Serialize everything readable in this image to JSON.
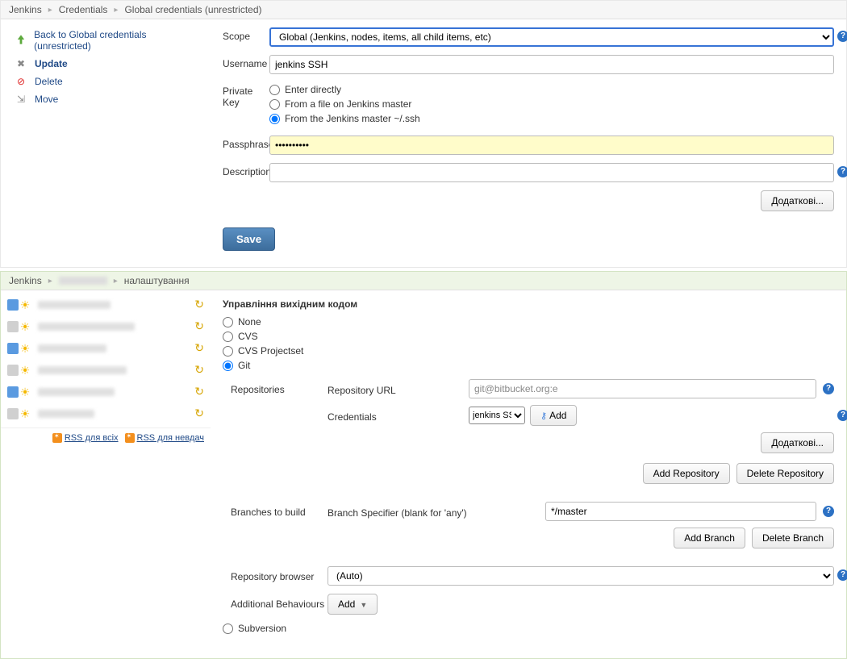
{
  "panel1": {
    "breadcrumbs": [
      "Jenkins",
      "Credentials",
      "Global credentials (unrestricted)"
    ],
    "sidebar": [
      {
        "icon": "arrow-up",
        "label": "Back to Global credentials (unrestricted)"
      },
      {
        "icon": "wrench",
        "label": "Update",
        "active": true
      },
      {
        "icon": "block",
        "label": "Delete"
      },
      {
        "icon": "move",
        "label": "Move"
      }
    ],
    "form": {
      "scope_label": "Scope",
      "scope_value": "Global (Jenkins, nodes, items, all child items, etc)",
      "username_label": "Username",
      "username_value": "jenkins SSH",
      "privatekey_label": "Private Key",
      "pk_options": [
        "Enter directly",
        "From a file on Jenkins master",
        "From the Jenkins master ~/.ssh"
      ],
      "pk_selected": 2,
      "passphrase_label": "Passphrase",
      "passphrase_value": "••••••••••",
      "description_label": "Description",
      "description_value": "",
      "advanced_btn": "Додаткові...",
      "save_btn": "Save"
    }
  },
  "panel2": {
    "breadcrumbs": [
      "Jenkins",
      "",
      "налаштування"
    ],
    "rss_all": "RSS для всіх",
    "rss_fail": "RSS для невдач",
    "scm": {
      "title": "Управління вихідним кодом",
      "options": [
        "None",
        "CVS",
        "CVS Projectset",
        "Git",
        "Subversion"
      ],
      "selected": 3,
      "repositories_label": "Repositories",
      "repo_url_label": "Repository URL",
      "repo_url_value": "git@bitbucket.org:e",
      "credentials_label": "Credentials",
      "credentials_value": "jenkins SSH",
      "add_cred_btn": "Add",
      "advanced_btn": "Додаткові...",
      "add_repo_btn": "Add Repository",
      "del_repo_btn": "Delete Repository",
      "branches_label": "Branches to build",
      "branch_spec_label": "Branch Specifier (blank for 'any')",
      "branch_spec_value": "*/master",
      "add_branch_btn": "Add Branch",
      "del_branch_btn": "Delete Branch",
      "repo_browser_label": "Repository browser",
      "repo_browser_value": "(Auto)",
      "behaviours_label": "Additional Behaviours",
      "behaviours_btn": "Add"
    }
  }
}
